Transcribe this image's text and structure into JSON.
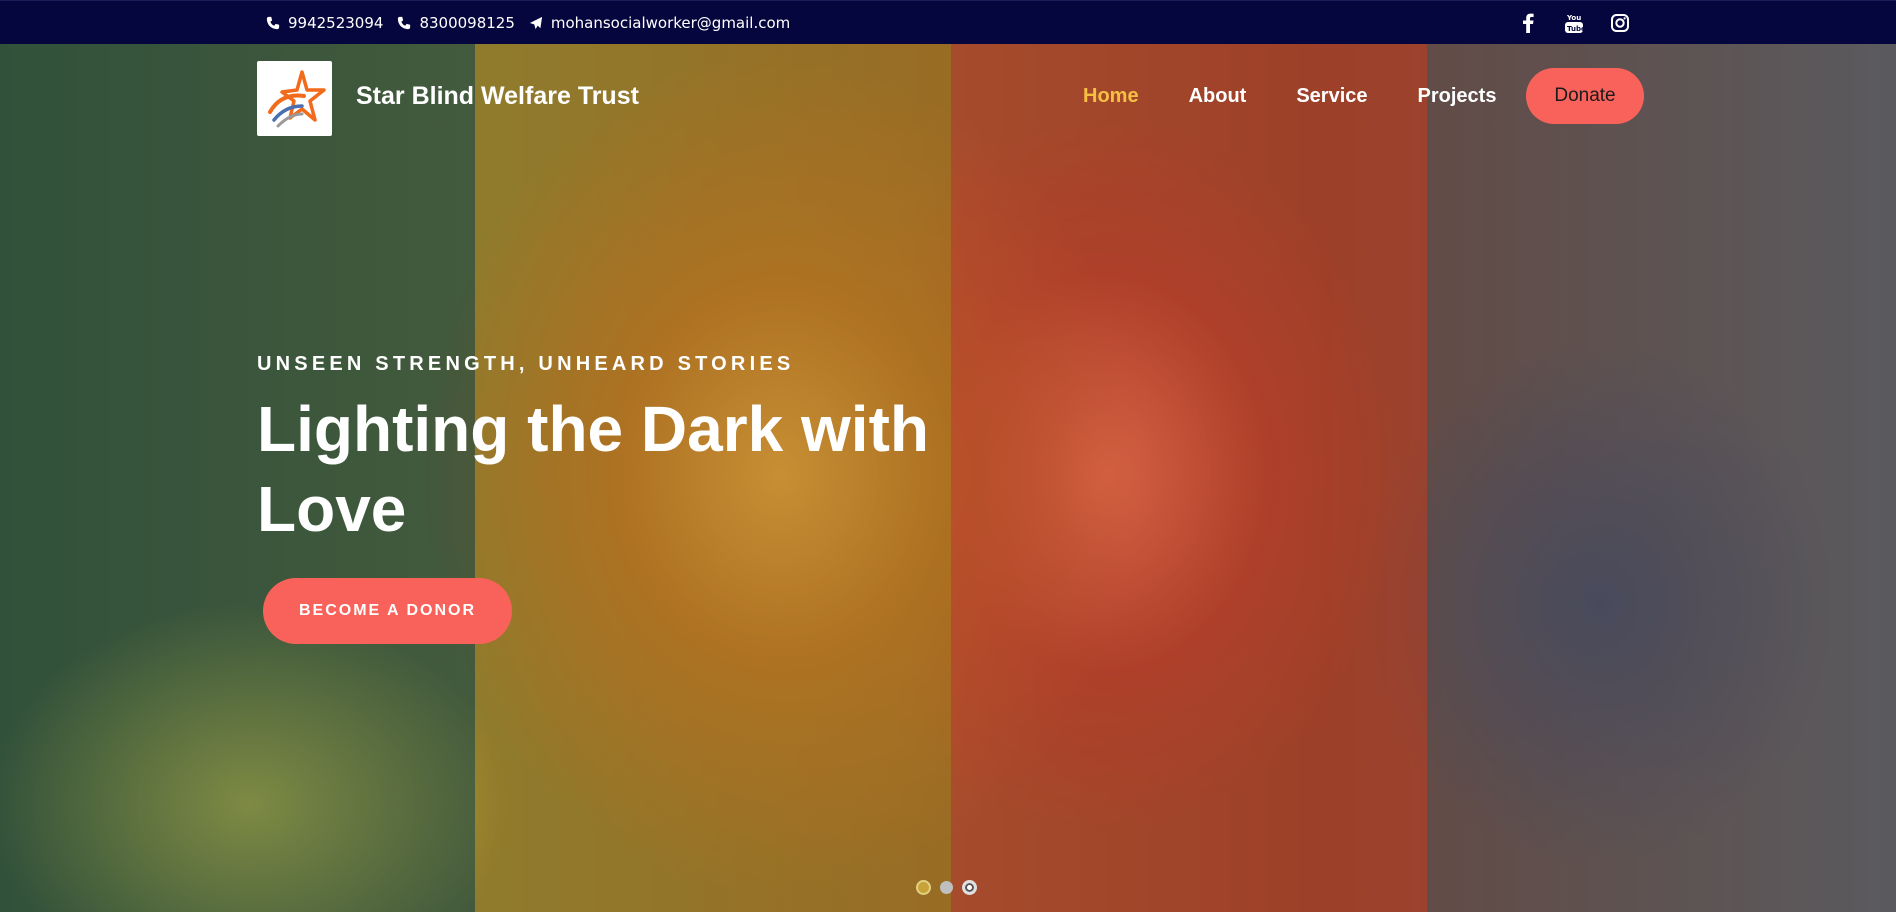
{
  "topbar": {
    "phone1": "9942523094",
    "phone2": "8300098125",
    "email": "mohansocialworker@gmail.com",
    "social_icons": [
      "facebook-icon",
      "youtube-icon",
      "instagram-icon"
    ]
  },
  "brand": {
    "name": "Star Blind Welfare Trust",
    "logo_icon": "star-logo-icon"
  },
  "nav": {
    "items": [
      "Home",
      "About",
      "Service",
      "Projects"
    ],
    "active": "Home",
    "donate_label": "Donate"
  },
  "hero": {
    "tagline": "UNSEEN STRENGTH, UNHEARD STORIES",
    "headline": "Lighting the Dark with Love",
    "cta_label": "BECOME A DONOR",
    "slides_count": 3,
    "active_slide": 3
  },
  "colors": {
    "topbar_bg": "#06063f",
    "accent": "#f9625a",
    "active_nav": "#f5c042",
    "text": "#ffffff"
  }
}
